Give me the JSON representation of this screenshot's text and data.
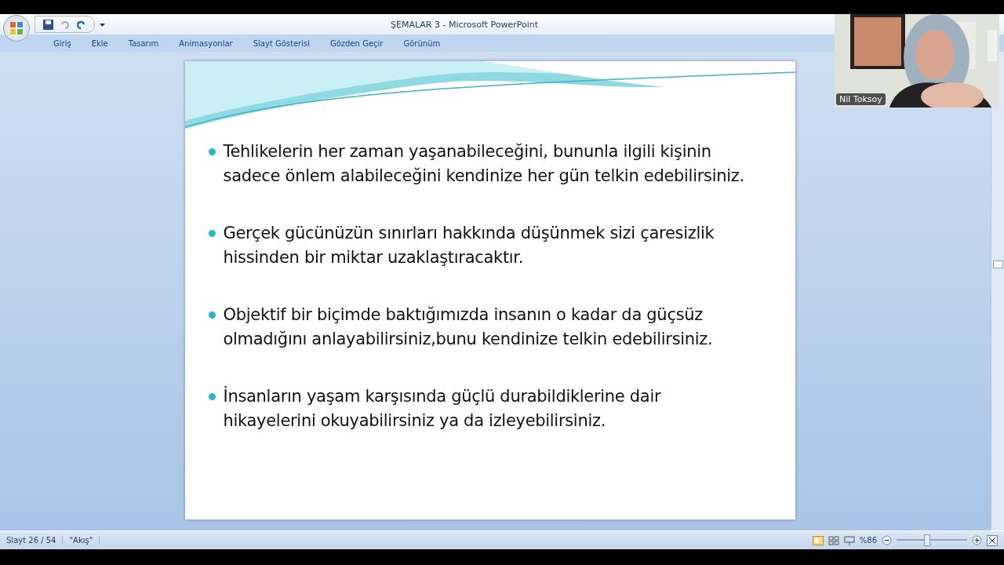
{
  "window": {
    "title": "ŞEMALAR 3 - Microsoft PowerPoint"
  },
  "ribbon_tabs": [
    {
      "label": "Giriş",
      "selected": false
    },
    {
      "label": "Ekle",
      "selected": false
    },
    {
      "label": "Tasarım",
      "selected": false
    },
    {
      "label": "Animasyonlar",
      "selected": false
    },
    {
      "label": "Slayt Gösterisi",
      "selected": false
    },
    {
      "label": "Gözden Geçir",
      "selected": false
    },
    {
      "label": "Görünüm",
      "selected": false
    }
  ],
  "slide": {
    "bullets": [
      "Tehlikelerin her zaman yaşanabileceğini, bununla ilgili  kişinin sadece önlem alabileceğini kendinize her gün telkin edebilirsiniz.",
      "Gerçek gücünüzün sınırları hakkında düşünmek sizi çaresizlik hissinden bir miktar uzaklaştıracaktır.",
      "Objektif bir biçimde  baktığımızda insanın o kadar da güçsüz olmadığını anlayabilirsiniz,bunu kendinize telkin edebilirsiniz.",
      "İnsanların yaşam karşısında güçlü durabildiklerine  dair hikayelerini okuyabilirsiniz ya da izleyebilirsiniz."
    ]
  },
  "webcam": {
    "kind": "picture",
    "name": "Nil Toksoy"
  },
  "status_bar": {
    "slide": "Slayt 26 / 54",
    "theme": "\"Akış\"",
    "zoom": "%86",
    "zoom_level": {
      "level": 0.43
    }
  }
}
